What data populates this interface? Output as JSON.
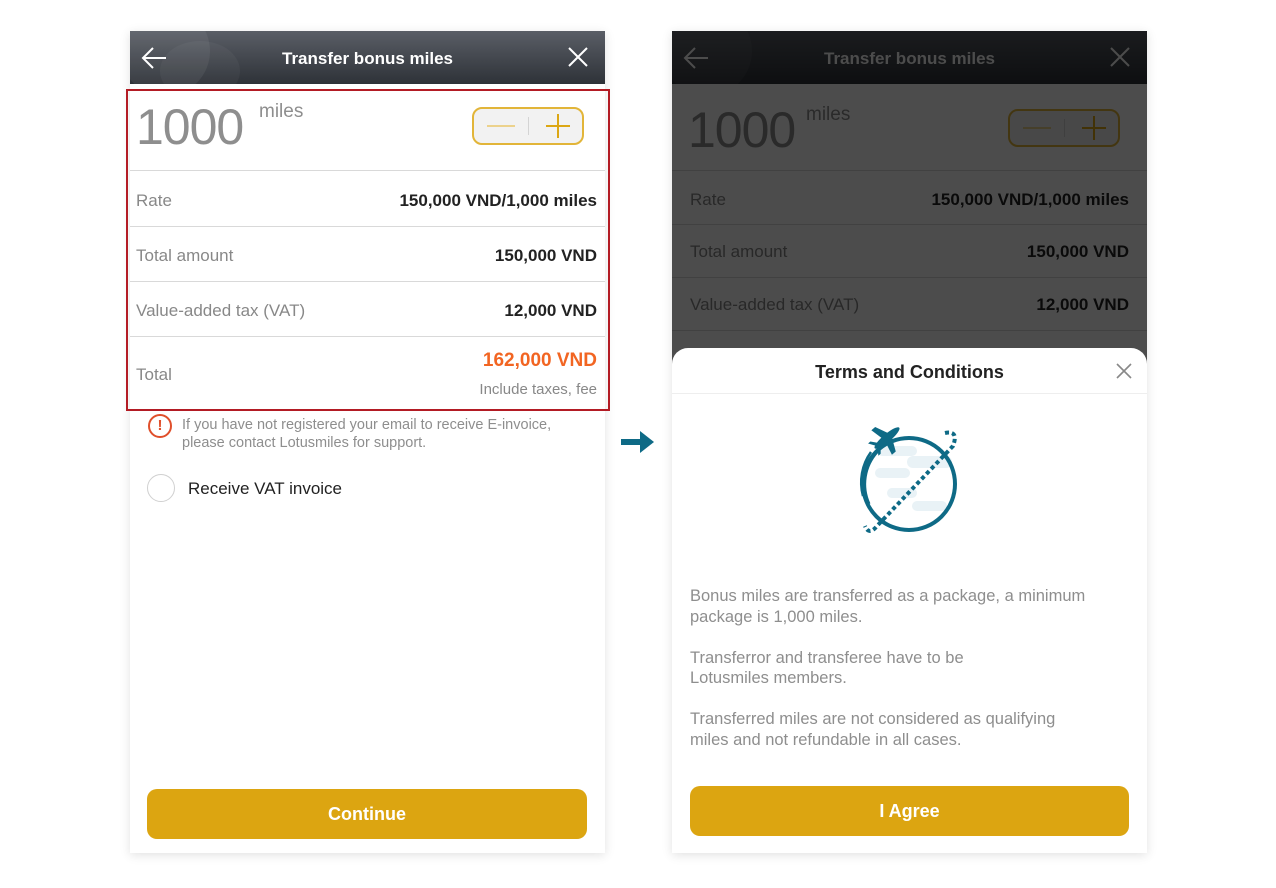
{
  "colors": {
    "accent_gold": "#dca511",
    "total_orange": "#f26522",
    "highlight_red": "#b31b24",
    "icon_teal": "#0e6a86"
  },
  "left_screen": {
    "header": {
      "title": "Transfer bonus miles",
      "back_icon": "arrow-left-icon",
      "close_icon": "close-icon"
    },
    "miles": {
      "value": "1000",
      "unit": "miles"
    },
    "stepper": {
      "decrement_icon": "minus-icon",
      "increment_icon": "plus-icon"
    },
    "rows": [
      {
        "label": "Rate",
        "value": "150,000 VND/1,000 miles"
      },
      {
        "label": "Total amount",
        "value": "150,000 VND"
      },
      {
        "label": "Value-added tax (VAT)",
        "value": "12,000 VND"
      }
    ],
    "total": {
      "label": "Total",
      "value": "162,000 VND",
      "note": "Include taxes, fee"
    },
    "notice": {
      "icon": "!",
      "text": "If you have not registered your email to receive E-invoice, please contact Lotusmiles for support."
    },
    "vat_option": {
      "label": "Receive VAT invoice",
      "checked": false
    },
    "continue_label": "Continue"
  },
  "right_screen": {
    "header": {
      "title": "Transfer bonus miles"
    },
    "miles": {
      "value": "1000",
      "unit": "miles"
    },
    "rows": [
      {
        "label": "Rate",
        "value": "150,000 VND/1,000 miles"
      },
      {
        "label": "Total amount",
        "value": "150,000 VND"
      },
      {
        "label": "Value-added tax (VAT)",
        "value": "12,000 VND"
      }
    ],
    "sheet": {
      "title": "Terms and Conditions",
      "illustration": "plane-globe-icon",
      "terms": [
        "Bonus miles are transferred as a package, a minimum package is 1,000 miles.",
        "Transferror and transferee have to be Lotusmiles members.",
        "Transferred miles are not considered as qualifying miles and not refundable in all cases."
      ],
      "agree_label": "I Agree"
    }
  },
  "flow_arrow": "arrow-right-icon"
}
